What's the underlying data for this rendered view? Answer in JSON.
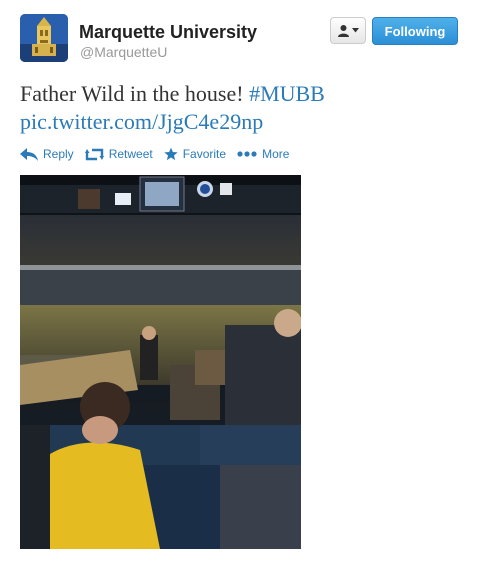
{
  "author": {
    "name": "Marquette University",
    "handle": "@MarquetteU"
  },
  "buttons": {
    "follow_label": "Following"
  },
  "tweet": {
    "text": "Father Wild in the house! ",
    "hashtag": "#MUBB",
    "link": "pic.twitter.com/JjgC4e29np"
  },
  "actions": {
    "reply": "Reply",
    "retweet": "Retweet",
    "favorite": "Favorite",
    "more": "More"
  },
  "colors": {
    "link": "#2b7bb9",
    "follow_button": "#2c8fd6"
  }
}
